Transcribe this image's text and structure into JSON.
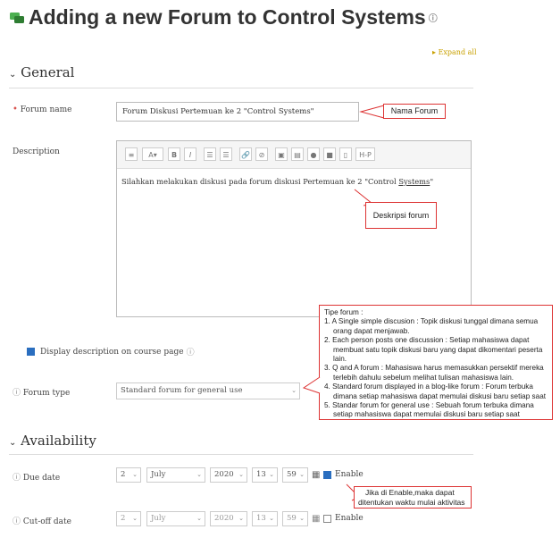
{
  "header": {
    "title": "Adding a new Forum to Control Systems",
    "help_icon": "help-circle-icon",
    "expand_all": "Expand all"
  },
  "general": {
    "heading": "General",
    "forum_name": {
      "label": "Forum name",
      "value": "Forum Diskusi Pertemuan ke 2 \"Control Systems\"",
      "callout": "Nama Forum"
    },
    "description": {
      "label": "Description",
      "toolbar": [
        "≡",
        "A▾",
        "B",
        "I",
        "☷",
        "☷",
        "🔗",
        "⛓",
        "▣",
        "▤",
        "🎤",
        "■",
        "▤",
        "H-P"
      ],
      "text_before": "Silahkan melakukan diskusi pada forum diskusi Pertemuan ke 2 \"Control ",
      "text_underlined": "Systems",
      "text_after": "\"",
      "callout": "Deskripsi forum"
    },
    "display_description": {
      "label": "Display description on course page",
      "checked": true
    },
    "forum_type": {
      "label": "Forum type",
      "value": "Standard forum for general use"
    }
  },
  "tip": {
    "title": "Tipe forum :",
    "items": [
      [
        "1. A Single simple discusion : Topik diskusi tunggal dimana semua",
        "orang dapat menjawab."
      ],
      [
        "2. Each person posts one discussion : Setiap mahasiswa dapat",
        "membuat satu topik diskusi baru yang dapat dikomentari peserta",
        "lain."
      ],
      [
        "3. Q and A forum : Mahasiswa harus memasukkan persektif mereka",
        "terlebih dahulu sebelum melihat tulisan mahasiswa lain."
      ],
      [
        "4. Standard forum displayed in a blog-like forum : Forum terbuka",
        "dimana setiap mahasiswa dapat memulai diskusi baru setiap saat"
      ],
      [
        "5. Standar forum for general use : Sebuah forum terbuka dimana",
        "setiap mahasiswa dapat memulai diskusi baru setiap saat"
      ]
    ]
  },
  "availability": {
    "heading": "Availability",
    "due_date": {
      "label": "Due date",
      "day": "2",
      "month": "July",
      "year": "2020",
      "hour": "13",
      "minute": "59",
      "enable": "Enable",
      "enabled": true
    },
    "cutoff_date": {
      "label": "Cut-off date",
      "day": "2",
      "month": "July",
      "year": "2020",
      "hour": "13",
      "minute": "59",
      "enable": "Enable",
      "enabled": false
    },
    "callout": [
      "Jika di Enable,maka dapat",
      "ditentukan waktu mulai aktivitas"
    ]
  },
  "colors": {
    "accent": "#2a6ebf",
    "required": "#d9534f",
    "callout_border": "#d33333",
    "link": "#c8a000"
  }
}
